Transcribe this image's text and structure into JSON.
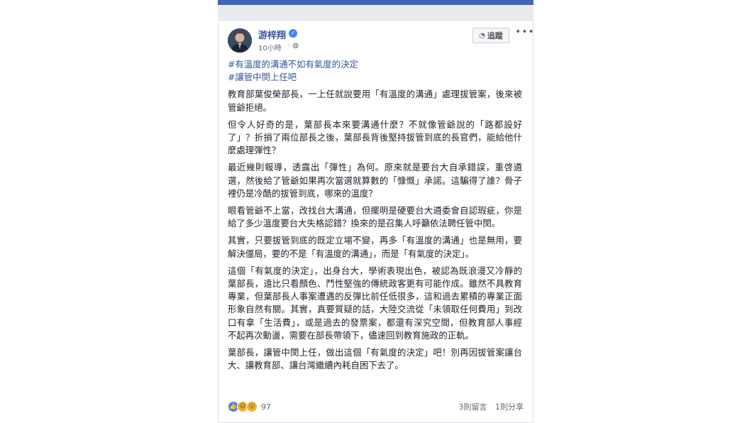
{
  "post": {
    "author": "游梓翔",
    "time": "10小時",
    "follow_label": "追蹤",
    "hashtags": [
      "#有溫度的溝通不如有氣度的決定",
      "#讓管中閔上任吧"
    ],
    "paragraphs": [
      "教育部葉俊榮部長，一上任就說要用「有溫度的溝通」處理拔管案，後來被管爺拒絕。",
      "但令人好奇的是，葉部長本來要溝通什麼？不就像管爺說的「路都設好了」？折損了兩位部長之後，葉部長背後堅持拔管到底的長官們，能給他什麼處理彈性？",
      "最近幾則報導，透露出「彈性」為何。原來就是要台大自承錯誤，重啓遴選，然後給了管爺如果再次當選就算數的「慷慨」承諾。這騙得了誰？骨子裡仍是冷酷的拔管到底，哪來的溫度？",
      "眼看管爺不上當，改找台大溝通，但擺明是硬要台大遴委會自認瑕疵，你是給了多少溫度要台大失格認錯？換來的是召集人呼籲依法聘任管中閔。",
      "其實，只要拔管到底的既定立場不變，再多「有溫度的溝通」也是無用，要解決僵局，要的不是「有溫度的溝通」，而是「有氣度的決定」。",
      "這個「有氣度的決定」，出身台大，學術表現出色，被認為既浪漫又冷靜的葉部長，遠比只看顏色、鬥性堅強的傳統政客更有可能作成。雖然不具教育專業，但葉部長人事案遭遇的反彈比前任低很多，這和過去累積的專業正面形象自然有關。其實，真要質疑的話，大陸交流從「未領取任何費用」到改口有拿「生活費」，或是過去的發票案，都還有深究空間，但教育部人事經不起再次動盪，需要在部長帶領下，儘速回到教育施政的正軌。",
      "葉部長，讓管中閔上任，做出這個「有氣度的決定」吧！別再因拔管案讓台大、讓教育部、讓台灣繼續內耗自困下去了。"
    ],
    "reaction_count": "97",
    "comments": "3則留言",
    "shares": "1則分享",
    "verified_icon": "check-icon",
    "colors": {
      "link": "#365899",
      "topbar": "#4267b2"
    }
  }
}
